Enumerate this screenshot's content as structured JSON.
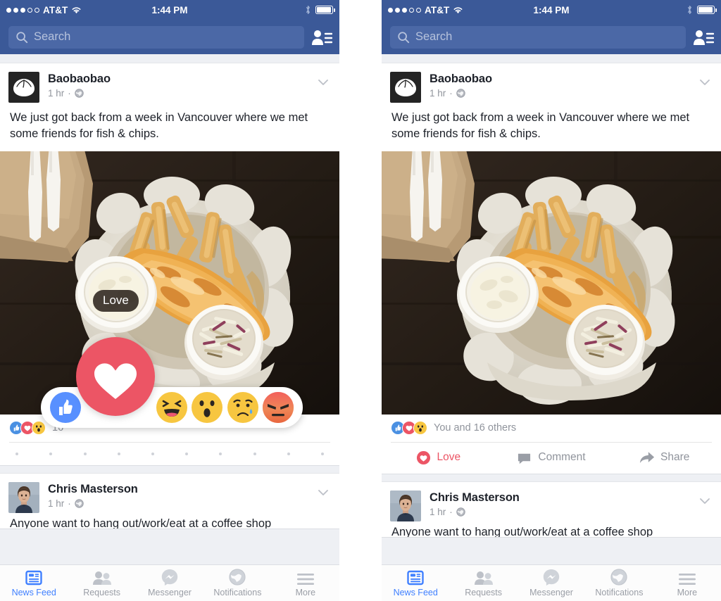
{
  "status_bar": {
    "carrier": "AT&T",
    "time": "1:44 PM",
    "signal_dots_filled": 3,
    "signal_dots_total": 5,
    "wifi_icon": "wifi-icon",
    "bluetooth_icon": "bluetooth-icon",
    "battery_icon": "battery-icon"
  },
  "nav": {
    "search_placeholder": "Search",
    "search_value": "",
    "search_icon": "search-icon",
    "friend_requests_icon": "friend-requests-icon"
  },
  "post": {
    "author": "Baobaobao",
    "avatar_icon": "bao-bun-avatar",
    "time": "1 hr",
    "separator": "·",
    "privacy_icon": "globe-icon",
    "menu_icon": "chevron-down-icon",
    "text": "We just got back from a week in Vancouver where we met some friends for fish & chips.",
    "photo_alt": "fish-and-chips-photo",
    "reactions": {
      "badges": [
        "like-badge",
        "love-badge",
        "wow-badge"
      ],
      "summary_left": "16",
      "summary_right": "You and 16 others"
    },
    "actions": [
      {
        "label": "Love",
        "icon": "love-heart-icon",
        "active": true
      },
      {
        "label": "Comment",
        "icon": "comment-bubble-icon",
        "active": false
      },
      {
        "label": "Share",
        "icon": "share-arrow-icon",
        "active": false
      }
    ]
  },
  "reaction_picker": {
    "tooltip": "Love",
    "selected": "love",
    "options": [
      {
        "name": "Like",
        "icon": "like-thumb-icon"
      },
      {
        "name": "Love",
        "icon": "love-heart-icon"
      },
      {
        "name": "Haha",
        "icon": "haha-emoji-icon"
      },
      {
        "name": "Wow",
        "icon": "wow-emoji-icon"
      },
      {
        "name": "Sad",
        "icon": "sad-emoji-icon"
      },
      {
        "name": "Angry",
        "icon": "angry-emoji-icon"
      }
    ]
  },
  "post2": {
    "author": "Chris Masterson",
    "avatar_icon": "chris-masterson-avatar",
    "time": "1 hr",
    "separator": "·",
    "privacy_icon": "globe-icon",
    "menu_icon": "chevron-down-icon",
    "text": "Anyone want to hang out/work/eat at a coffee shop"
  },
  "tab_bar": {
    "items": [
      {
        "label": "News Feed",
        "icon": "news-feed-icon",
        "active": true
      },
      {
        "label": "Requests",
        "icon": "requests-icon",
        "active": false
      },
      {
        "label": "Messenger",
        "icon": "messenger-icon",
        "active": false
      },
      {
        "label": "Notifications",
        "icon": "notifications-icon",
        "active": false
      },
      {
        "label": "More",
        "icon": "more-hamburger-icon",
        "active": false
      }
    ]
  },
  "colors": {
    "fb_blue": "#3b5998",
    "search_field": "#4b68a6",
    "active_tab": "#4080ff",
    "love_red": "#ec5565",
    "like_blue": "#4a90e2",
    "emoji_yellow": "#f7c640",
    "page_bg": "#eef0f4",
    "text_primary": "#1d2129",
    "text_muted": "#90949c"
  }
}
